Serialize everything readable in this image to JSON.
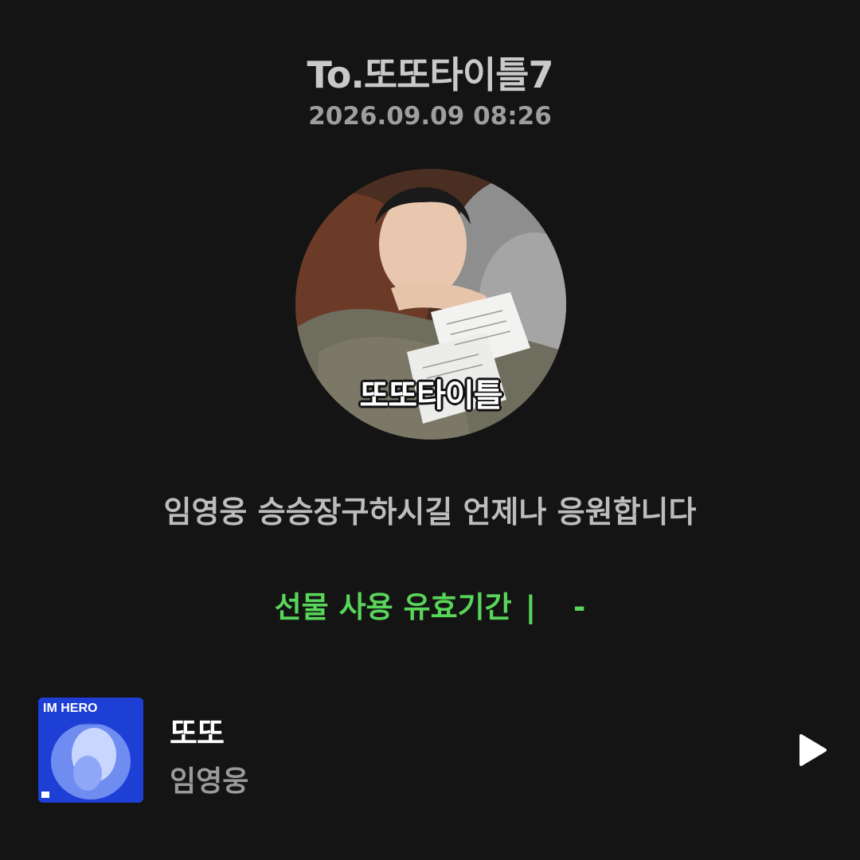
{
  "header": {
    "title": "To.또또타이틀7",
    "date": "2026.09.09 08:26"
  },
  "profile": {
    "caption": "또또타이틀"
  },
  "message": "임영웅 승승장구하시길 언제나 응원합니다",
  "gift": {
    "validity_label": "선물 사용 유효기간",
    "separator": "|",
    "validity_value": "-"
  },
  "track": {
    "title": "또또",
    "artist": "임영웅",
    "album_art_text": "IM HERO",
    "play_icon": "play-icon"
  },
  "colors": {
    "background": "#141414",
    "accent": "#58d65a",
    "title_text": "#c9c9c9",
    "secondary_text": "#9e9e9e"
  }
}
